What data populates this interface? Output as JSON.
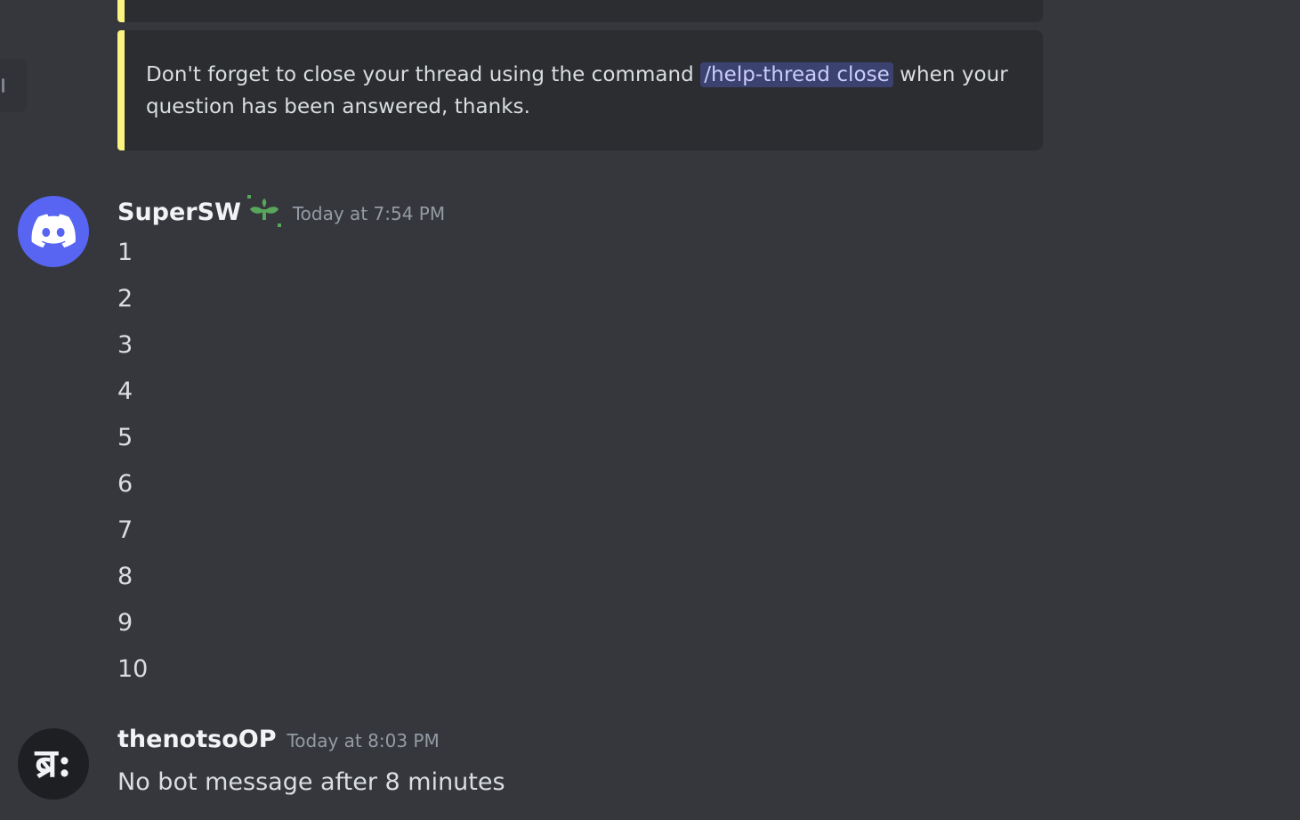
{
  "embed": {
    "text_before": "Don't forget to close your thread using the command ",
    "command": "/help-thread close",
    "text_after": " when your question has been answered, thanks.",
    "accent_color": "#fbf380"
  },
  "messages": [
    {
      "username": "SuperSW",
      "badge_icon": "sprout-icon",
      "timestamp": "Today at 7:54 PM",
      "avatar_icon": "discord-logo-icon",
      "lines": [
        "1",
        "2",
        "3",
        "4",
        "5",
        "6",
        "7",
        "8",
        "9",
        "10"
      ]
    },
    {
      "username": "thenotsoOP",
      "timestamp": "Today at 8:03 PM",
      "avatar_glyph": "ब्र:",
      "text": "No bot message after 8 minutes"
    }
  ],
  "colors": {
    "background": "#36373d",
    "embed_background": "#2b2d31",
    "discord_blurple": "#5865f2",
    "command_highlight": "#3c4270",
    "badge_green": "#57a65b"
  }
}
